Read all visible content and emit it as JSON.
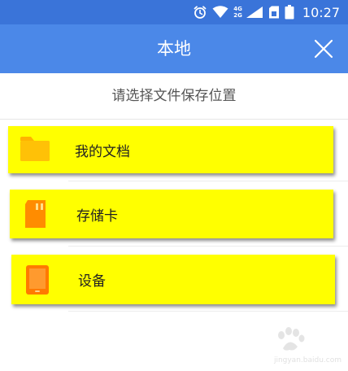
{
  "status_bar": {
    "time": "10:27",
    "network_top": "4G",
    "network_bottom": "2G",
    "icons": [
      "alarm-icon",
      "wifi-icon",
      "signal-icon",
      "sim-icon",
      "battery-icon"
    ]
  },
  "header": {
    "title": "本地",
    "close_icon": "close-icon",
    "background": "#4b88e8"
  },
  "prompt": "请选择文件保存位置",
  "options": [
    {
      "label": "我的文档",
      "icon": "folder-icon",
      "icon_color": "#ffc107"
    },
    {
      "label": "存储卡",
      "icon": "sd-card-icon",
      "icon_color": "#ff8c00"
    },
    {
      "label": "设备",
      "icon": "tablet-icon",
      "icon_color": "#ff7a00"
    }
  ],
  "highlight_color": "#ffff00",
  "watermark": {
    "logo_text": "Baidu经验",
    "url": "jingyan.baidu.com"
  }
}
